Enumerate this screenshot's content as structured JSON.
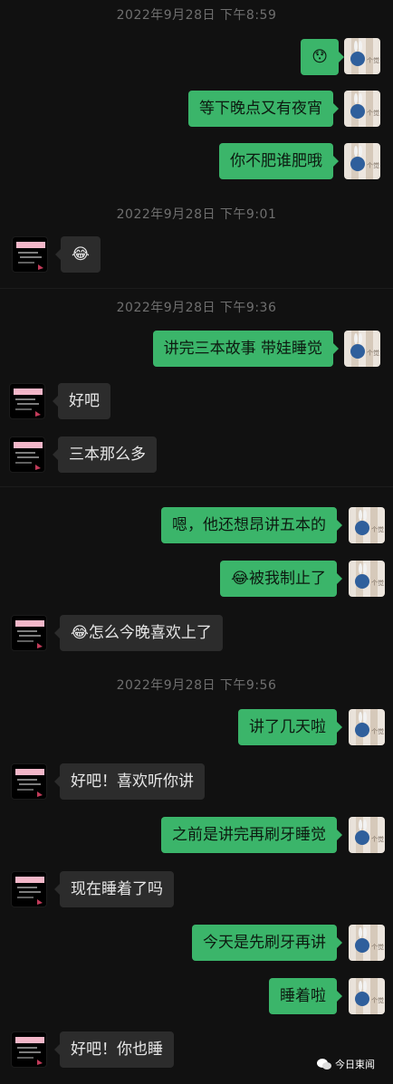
{
  "timestamps": [
    "2022年9月28日 下午8:59",
    "2022年9月28日 下午9:01",
    "2022年9月28日 下午9:36",
    "2022年9月28日 下午9:56"
  ],
  "messages": [
    {
      "side": "me",
      "text": "😯"
    },
    {
      "side": "me",
      "text": "等下晚点又有夜宵"
    },
    {
      "side": "me",
      "text": "你不肥谁肥哦"
    },
    {
      "side": "them",
      "text": "😂"
    },
    {
      "side": "me",
      "text": "讲完三本故事 带娃睡觉"
    },
    {
      "side": "them",
      "text": "好吧"
    },
    {
      "side": "them",
      "text": "三本那么多"
    },
    {
      "side": "me",
      "text": "嗯，他还想昂讲五本的"
    },
    {
      "side": "me",
      "text": "😂被我制止了"
    },
    {
      "side": "them",
      "text": "😂怎么今晚喜欢上了"
    },
    {
      "side": "me",
      "text": "讲了几天啦"
    },
    {
      "side": "them",
      "text": "好吧！喜欢听你讲"
    },
    {
      "side": "me",
      "text": "之前是讲完再刷牙睡觉"
    },
    {
      "side": "them",
      "text": "现在睡着了吗"
    },
    {
      "side": "me",
      "text": "今天是先刷牙再讲"
    },
    {
      "side": "me",
      "text": "睡着啦"
    },
    {
      "side": "them",
      "text": "好吧！你也睡"
    }
  ],
  "watermark": {
    "text": "今日東闻",
    "icon": "wechat-icon"
  },
  "colors": {
    "background": "#111111",
    "me_bubble": "#3bb56a",
    "them_bubble": "#2c2c2c",
    "timestamp": "#6f6f6f"
  }
}
